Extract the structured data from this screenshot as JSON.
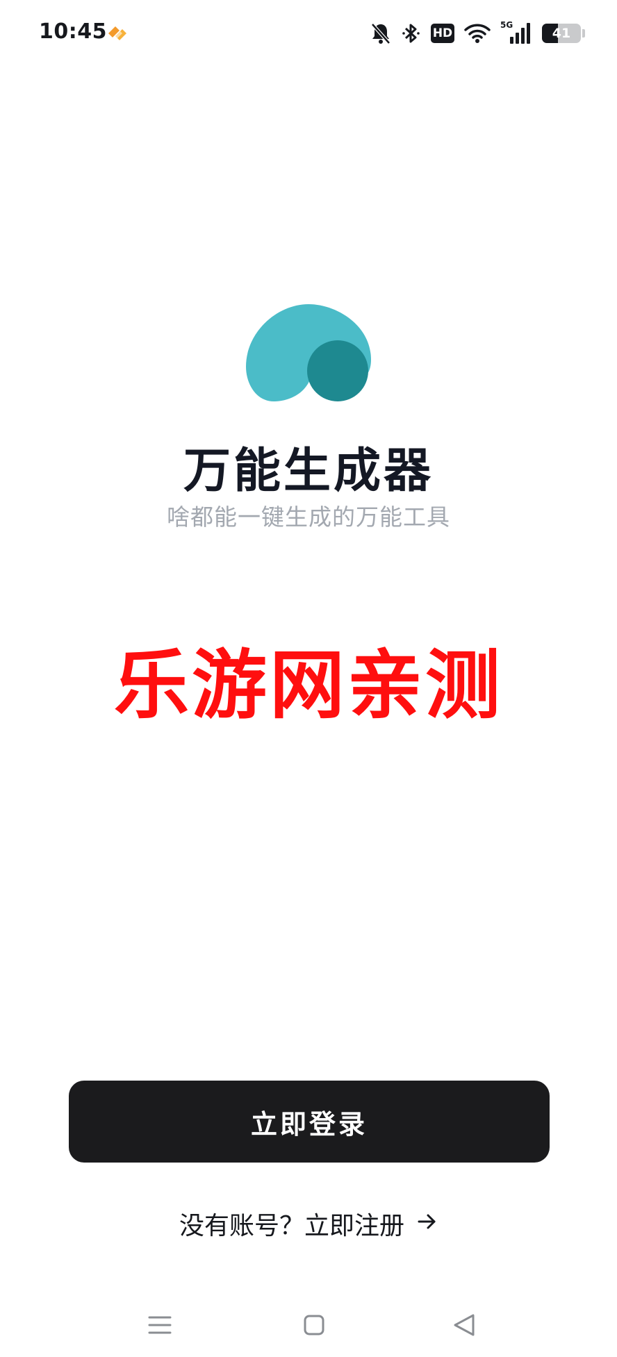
{
  "status_bar": {
    "time": "10:45",
    "signal_label": "5G",
    "hd_label": "HD",
    "battery_level": 41,
    "battery_text": "41"
  },
  "app": {
    "title": "万能生成器",
    "subtitle": "啥都能一键生成的万能工具",
    "watermark": "乐游网亲测"
  },
  "actions": {
    "login_label": "立即登录",
    "register_label": "没有账号？立即注册"
  },
  "colors": {
    "logo_light": "#4bbcc8",
    "logo_dark": "#1e8990",
    "watermark": "#ff0f0f",
    "button_bg": "#1b1b1d"
  },
  "icons": {
    "status": [
      "app-notification-icon",
      "mute-icon",
      "bluetooth-icon",
      "hd-icon",
      "wifi-icon",
      "signal-icon",
      "battery-icon"
    ],
    "nav": [
      "menu-icon",
      "home-icon",
      "back-icon"
    ],
    "register_arrow": "arrow-right-icon"
  }
}
